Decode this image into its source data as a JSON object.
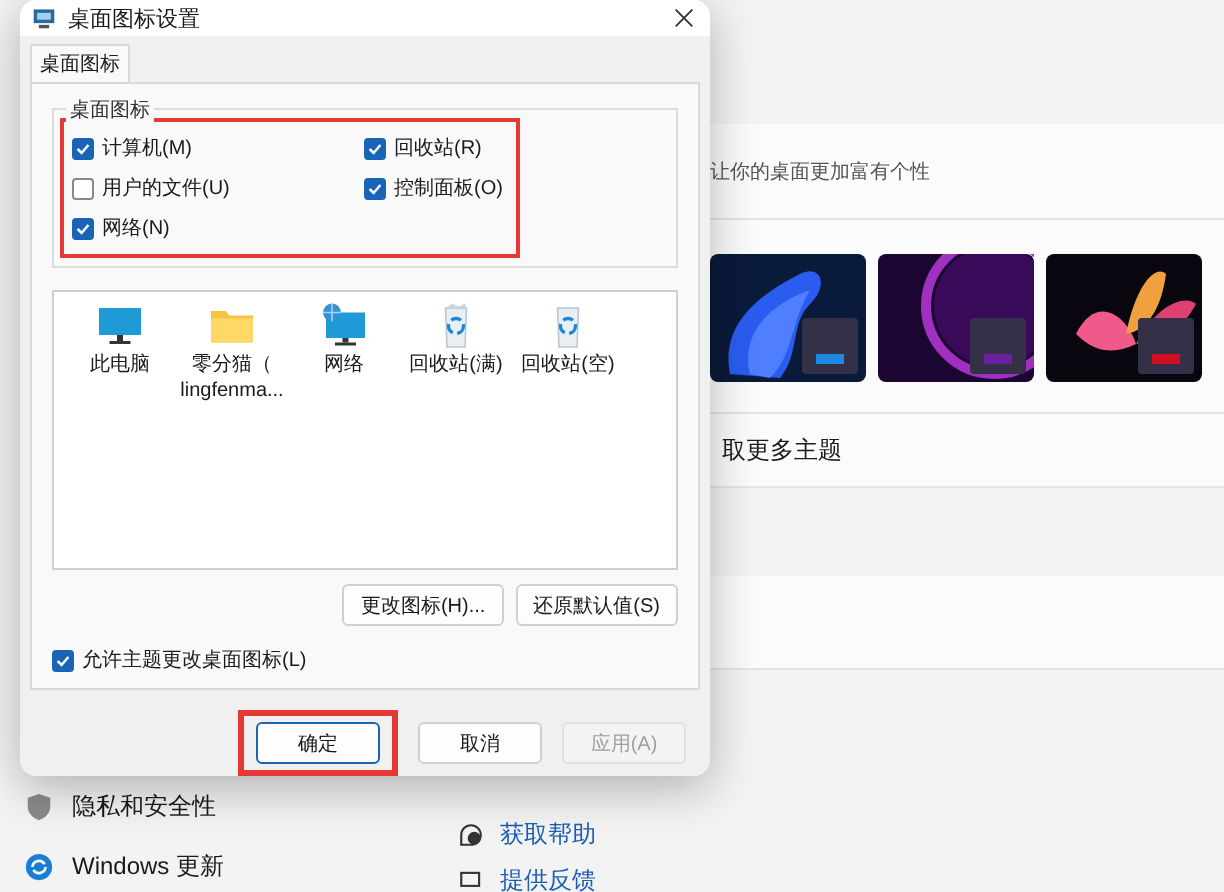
{
  "dialog": {
    "title": "桌面图标设置",
    "tabs": [
      {
        "label": "桌面图标",
        "selected": true
      }
    ],
    "group": {
      "title": "桌面图标",
      "highlighted": true,
      "checkboxes": [
        {
          "label": "计算机(M)",
          "checked": true
        },
        {
          "label": "回收站(R)",
          "checked": true
        },
        {
          "label": "用户的文件(U)",
          "checked": false
        },
        {
          "label": "控制面板(O)",
          "checked": true
        },
        {
          "label": "网络(N)",
          "checked": true
        }
      ]
    },
    "icons": [
      {
        "kind": "monitor",
        "label": "此电脑",
        "selected": false
      },
      {
        "kind": "folder",
        "label": "零分猫（ lingfenma...",
        "selected": false
      },
      {
        "kind": "network",
        "label": "网络",
        "selected": false
      },
      {
        "kind": "bin-full",
        "label": "回收站(满)",
        "selected": false
      },
      {
        "kind": "bin-empty",
        "label": "回收站(空)",
        "selected": false
      }
    ],
    "icon_buttons": [
      "更改图标(H)...",
      "还原默认值(S)"
    ],
    "allow_themes": {
      "label": "允许主题更改桌面图标(L)",
      "checked": true
    },
    "buttons": [
      {
        "label": "确定",
        "kind": "default",
        "highlighted": true,
        "disabled": false
      },
      {
        "label": "取消",
        "kind": "normal",
        "highlighted": false,
        "disabled": false
      },
      {
        "label": "应用(A)",
        "kind": "normal",
        "highlighted": false,
        "disabled": true
      }
    ]
  },
  "settings": {
    "subtitle": "让你的桌面更加富有个性",
    "more_themes": "取更多主题",
    "sidebar": [
      {
        "label": "隐私和安全性"
      },
      {
        "label": "Windows 更新"
      }
    ],
    "help_links": [
      {
        "label": "获取帮助"
      },
      {
        "label": "提供反馈"
      }
    ]
  }
}
